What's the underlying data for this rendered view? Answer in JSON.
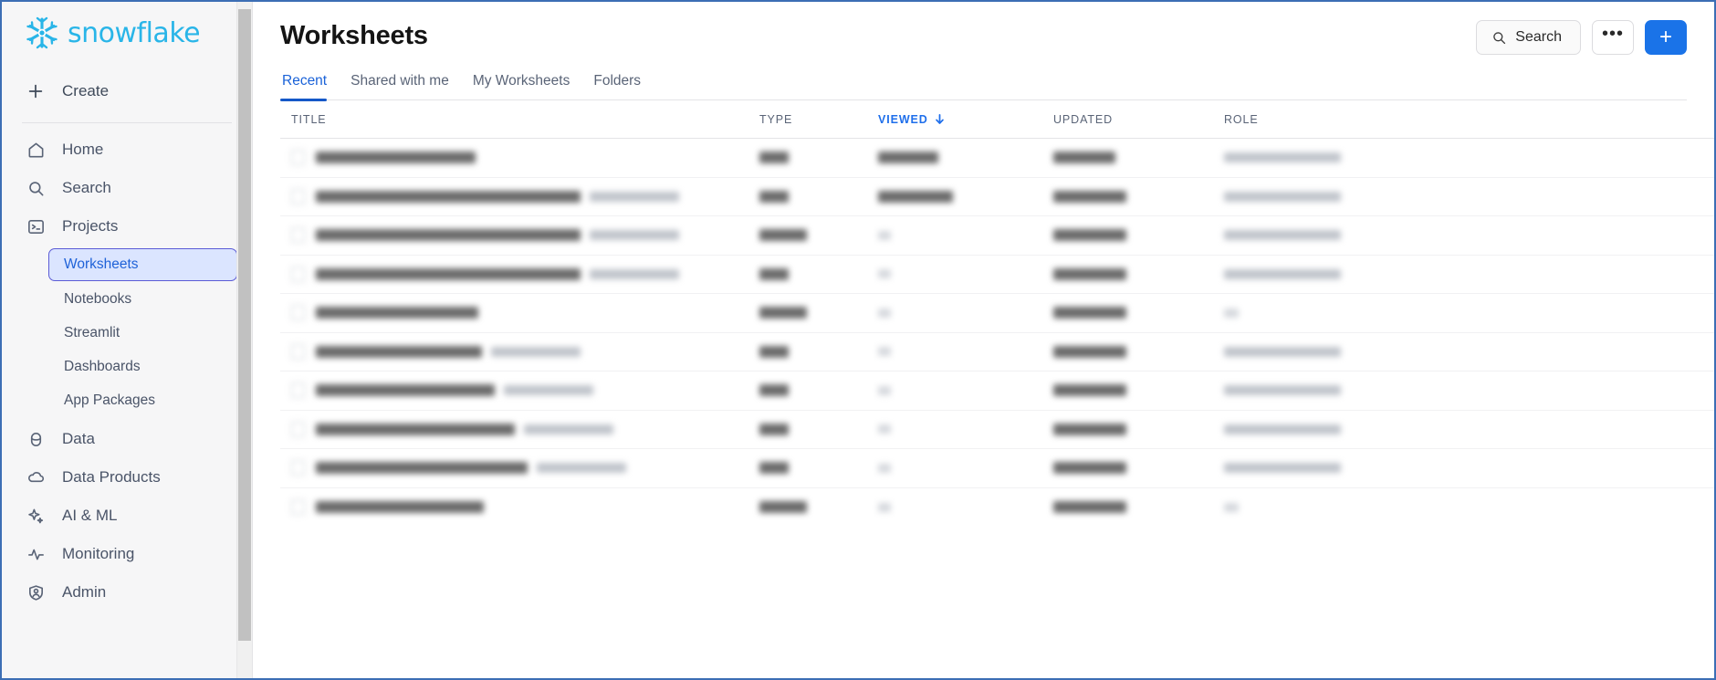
{
  "app": {
    "brand": "snowflake",
    "brand_color": "#29b5e8",
    "accent_color": "#1a73e8",
    "active_color": "#1f62d8"
  },
  "sidebar": {
    "create": {
      "label": "Create",
      "icon": "plus-icon"
    },
    "items": [
      {
        "label": "Home",
        "icon": "home-icon",
        "active": false
      },
      {
        "label": "Search",
        "icon": "search-icon",
        "active": false
      },
      {
        "label": "Projects",
        "icon": "terminal-icon",
        "active": false
      },
      {
        "label": "Data",
        "icon": "database-icon",
        "active": false
      },
      {
        "label": "Data Products",
        "icon": "cloud-icon",
        "active": false
      },
      {
        "label": "AI & ML",
        "icon": "sparkle-icon",
        "active": false
      },
      {
        "label": "Monitoring",
        "icon": "activity-icon",
        "active": false
      },
      {
        "label": "Admin",
        "icon": "shield-user-icon",
        "active": false
      }
    ],
    "projects_subitems": [
      {
        "label": "Worksheets",
        "active": true
      },
      {
        "label": "Notebooks",
        "active": false
      },
      {
        "label": "Streamlit",
        "active": false
      },
      {
        "label": "Dashboards",
        "active": false
      },
      {
        "label": "App Packages",
        "active": false
      }
    ]
  },
  "header": {
    "title": "Worksheets",
    "search_label": "Search",
    "search_icon": "search-icon",
    "more_label": "•••",
    "more_icon": "ellipsis-icon",
    "add_label": "+",
    "add_icon": "plus-icon"
  },
  "tabs": [
    {
      "label": "Recent",
      "active": true
    },
    {
      "label": "Shared with me",
      "active": false
    },
    {
      "label": "My Worksheets",
      "active": false
    },
    {
      "label": "Folders",
      "active": false
    }
  ],
  "table": {
    "columns": [
      {
        "key": "title",
        "label": "TITLE",
        "sorted": false
      },
      {
        "key": "type",
        "label": "TYPE",
        "sorted": false
      },
      {
        "key": "viewed",
        "label": "VIEWED",
        "sorted": true,
        "sort_dir": "desc",
        "sort_icon": "arrow-down-icon"
      },
      {
        "key": "updated",
        "label": "UPDATED",
        "sorted": false
      },
      {
        "key": "role",
        "label": "ROLE",
        "sorted": false
      }
    ],
    "redacted": true,
    "rows": [
      {
        "title_w": 175,
        "sub_w": 0,
        "type_w": 32,
        "viewed_w": 66,
        "updated_w": 68,
        "role_w": 128
      },
      {
        "title_w": 290,
        "sub_w": 98,
        "type_w": 32,
        "viewed_w": 82,
        "updated_w": 80,
        "role_w": 128
      },
      {
        "title_w": 290,
        "sub_w": 98,
        "type_w": 52,
        "viewed_w": 14,
        "updated_w": 80,
        "role_w": 128
      },
      {
        "title_w": 290,
        "sub_w": 98,
        "type_w": 32,
        "viewed_w": 14,
        "updated_w": 80,
        "role_w": 128
      },
      {
        "title_w": 178,
        "sub_w": 0,
        "type_w": 52,
        "viewed_w": 14,
        "updated_w": 80,
        "role_w": 16
      },
      {
        "title_w": 182,
        "sub_w": 98,
        "type_w": 32,
        "viewed_w": 14,
        "updated_w": 80,
        "role_w": 128
      },
      {
        "title_w": 196,
        "sub_w": 98,
        "type_w": 32,
        "viewed_w": 14,
        "updated_w": 80,
        "role_w": 128
      },
      {
        "title_w": 218,
        "sub_w": 98,
        "type_w": 32,
        "viewed_w": 14,
        "updated_w": 80,
        "role_w": 128
      },
      {
        "title_w": 232,
        "sub_w": 98,
        "type_w": 32,
        "viewed_w": 14,
        "updated_w": 80,
        "role_w": 128
      },
      {
        "title_w": 184,
        "sub_w": 0,
        "type_w": 52,
        "viewed_w": 14,
        "updated_w": 80,
        "role_w": 16
      }
    ]
  },
  "scrollbar": {
    "orientation": "vertical",
    "thumb_top_pct": 1,
    "thumb_height_pct": 93
  }
}
